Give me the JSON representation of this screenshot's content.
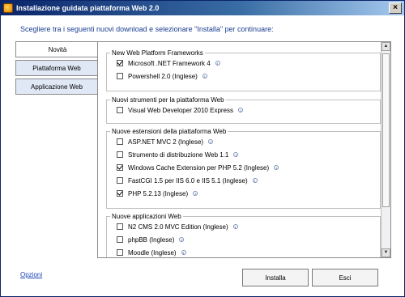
{
  "window": {
    "title": "Installazione guidata piattaforma Web 2.0",
    "close_glyph": "×"
  },
  "instruction": "Scegliere tra i seguenti nuovi download e selezionare \"Installa\" per continuare:",
  "tabs": [
    {
      "label": "Novità",
      "active": true
    },
    {
      "label": "Piattaforma Web",
      "active": false
    },
    {
      "label": "Applicazione Web",
      "active": false
    }
  ],
  "groups": [
    {
      "title": "New Web Platform Frameworks",
      "items": [
        {
          "label": "Microsoft .NET Framework 4",
          "checked": true
        },
        {
          "label": "Powershell 2.0 (Inglese)",
          "checked": false
        }
      ]
    },
    {
      "title": "Nuovi strumenti per la piattaforma Web",
      "items": [
        {
          "label": "Visual Web Developer 2010 Express",
          "checked": false
        }
      ]
    },
    {
      "title": "Nuove estensioni della piattaforma Web",
      "items": [
        {
          "label": "ASP.NET MVC 2 (Inglese)",
          "checked": false
        },
        {
          "label": "Strumento di distribuzione Web 1.1",
          "checked": false
        },
        {
          "label": "Windows Cache Extension per PHP 5.2 (Inglese)",
          "checked": true
        },
        {
          "label": "FastCGI 1.5 per IIS 6.0 e IIS 5.1 (Inglese)",
          "checked": false
        },
        {
          "label": "PHP 5.2.13 (Inglese)",
          "checked": true
        }
      ]
    },
    {
      "title": "Nuove applicazioni Web",
      "items": [
        {
          "label": "N2 CMS 2.0 MVC Edition (Inglese)",
          "checked": false
        },
        {
          "label": "phpBB (Inglese)",
          "checked": false
        },
        {
          "label": "Moodle (Inglese)",
          "checked": false
        }
      ]
    }
  ],
  "footer": {
    "options_link": "Opzioni",
    "install_label": "Installa",
    "exit_label": "Esci"
  },
  "icons": {
    "info": "info-icon",
    "checkbox_checked": "checkmark-icon"
  },
  "colors": {
    "title_gradient_start": "#0a246a",
    "title_gradient_end": "#a6caf0",
    "instruction_text": "#1a3d8f",
    "link": "#1a44b8"
  }
}
